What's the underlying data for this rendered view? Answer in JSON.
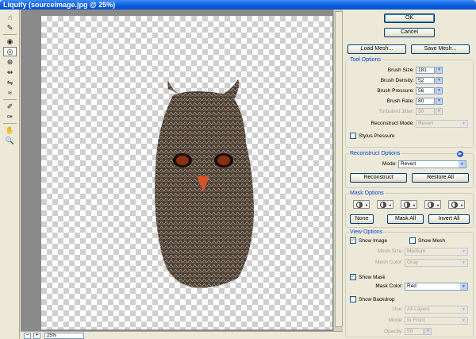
{
  "window": {
    "title": "Liquify (sourceimage.jpg @ 25%)"
  },
  "toolbar": {
    "tools": [
      {
        "icon": "forward-warp-icon",
        "glyph": "☝"
      },
      {
        "icon": "reconstruct-icon",
        "glyph": "✎"
      },
      {
        "icon": "twirl-clockwise-icon",
        "glyph": "◉"
      },
      {
        "icon": "pucker-icon",
        "glyph": "◎"
      },
      {
        "icon": "bloat-icon",
        "glyph": "⊕"
      },
      {
        "icon": "push-left-icon",
        "glyph": "⇹"
      },
      {
        "icon": "mirror-icon",
        "glyph": "⇋"
      },
      {
        "icon": "turbulence-icon",
        "glyph": "≈"
      },
      {
        "icon": "freeze-mask-icon",
        "glyph": "✐"
      },
      {
        "icon": "thaw-mask-icon",
        "glyph": "✑"
      },
      {
        "icon": "hand-icon",
        "glyph": "✋"
      },
      {
        "icon": "zoom-icon",
        "glyph": "🔍"
      }
    ]
  },
  "status": {
    "zoom_out": "−",
    "zoom_in": "+",
    "zoom": "25%"
  },
  "buttons": {
    "ok": "OK",
    "cancel": "Cancel",
    "load_mesh": "Load Mesh...",
    "save_mesh": "Save Mesh..."
  },
  "tool_options": {
    "title": "Tool Options",
    "brush_size_label": "Brush Size:",
    "brush_size": "181",
    "brush_density_label": "Brush Density:",
    "brush_density": "52",
    "brush_pressure_label": "Brush Pressure:",
    "brush_pressure": "56",
    "brush_rate_label": "Brush Rate:",
    "brush_rate": "80",
    "turbulent_jitter_label": "Turbulent Jitter:",
    "turbulent_jitter": "50",
    "reconstruct_mode_label": "Reconstruct Mode:",
    "reconstruct_mode": "Revert",
    "stylus_pressure_label": "Stylus Pressure"
  },
  "reconstruct_options": {
    "title": "Reconstruct Options",
    "mode_label": "Mode:",
    "mode": "Revert",
    "reconstruct_button": "Reconstruct",
    "restore_all_button": "Restore All"
  },
  "mask_options": {
    "title": "Mask Options",
    "none_button": "None",
    "mask_all_button": "Mask All",
    "invert_all_button": "Invert All"
  },
  "view_options": {
    "title": "View Options",
    "show_image_label": "Show Image",
    "show_image_checked": true,
    "show_mesh_label": "Show Mesh",
    "show_mesh_checked": false,
    "mesh_size_label": "Mesh Size:",
    "mesh_size": "Medium",
    "mesh_color_label": "Mesh Color:",
    "mesh_color": "Gray",
    "show_mask_label": "Show Mask",
    "show_mask_checked": true,
    "mask_color_label": "Mask Color:",
    "mask_color": "Red",
    "show_backdrop_label": "Show Backdrop",
    "show_backdrop_checked": false,
    "use_label": "Use:",
    "use": "All Layers",
    "mode_label": "Mode:",
    "mode": "In Front",
    "opacity_label": "Opacity:",
    "opacity": "50"
  },
  "colors": {
    "title_bar": "#0a5ae0",
    "group_title": "#0046d5",
    "mask_color": "#ff0000"
  }
}
